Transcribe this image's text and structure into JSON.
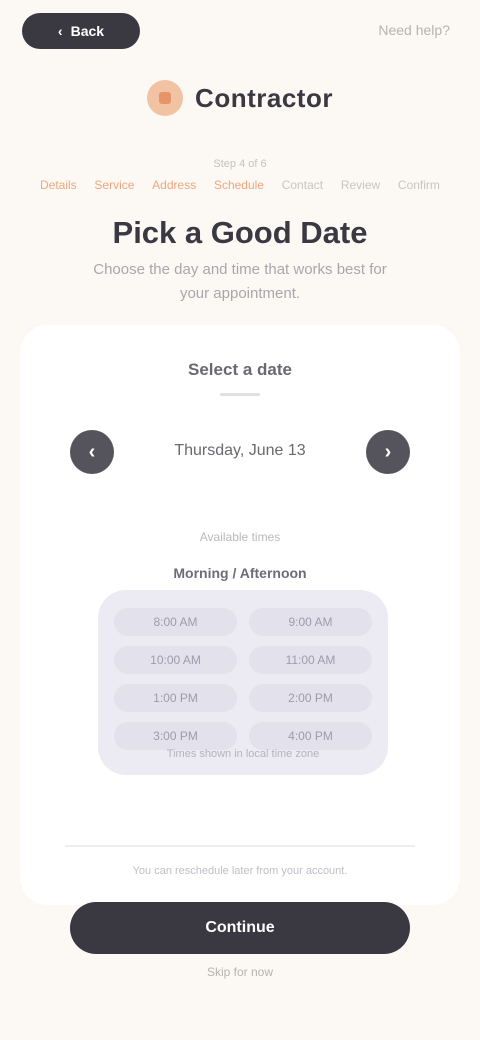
{
  "header": {
    "back_label": "Back",
    "top_link_label": "Need help?"
  },
  "brand": {
    "name": "Contractor"
  },
  "stepper": {
    "count_label": "Step 4 of 6",
    "labels": [
      {
        "text": "Details",
        "state": "done"
      },
      {
        "text": "Service",
        "state": "done"
      },
      {
        "text": "Address",
        "state": "done"
      },
      {
        "text": "Schedule",
        "state": "done"
      },
      {
        "text": "Contact",
        "state": "todo"
      },
      {
        "text": "Review",
        "state": "todo"
      },
      {
        "text": "Confirm",
        "state": "todo"
      }
    ]
  },
  "heading": {
    "title": "Pick a Good Date",
    "subtitle": "Choose the day and time that works best for your appointment."
  },
  "card": {
    "label": "Select a date",
    "date_text": "Thursday, June 13",
    "prev_icon": "chevron-left-icon",
    "next_icon": "chevron-right-icon",
    "slot_caption": "Available times",
    "slot_heading": "Morning / Afternoon",
    "slots": [
      "8:00 AM",
      "9:00 AM",
      "10:00 AM",
      "11:00 AM",
      "1:00 PM",
      "2:00 PM",
      "3:00 PM",
      "4:00 PM"
    ],
    "slot_empty": "Times shown in local time zone",
    "note": "You can reschedule later from your account."
  },
  "cta": {
    "label": "Continue"
  },
  "footer": {
    "text": "Skip for now"
  },
  "colors": {
    "accent": "#f0a57a",
    "dark": "#3a3942",
    "background": "#fcf9f5"
  }
}
